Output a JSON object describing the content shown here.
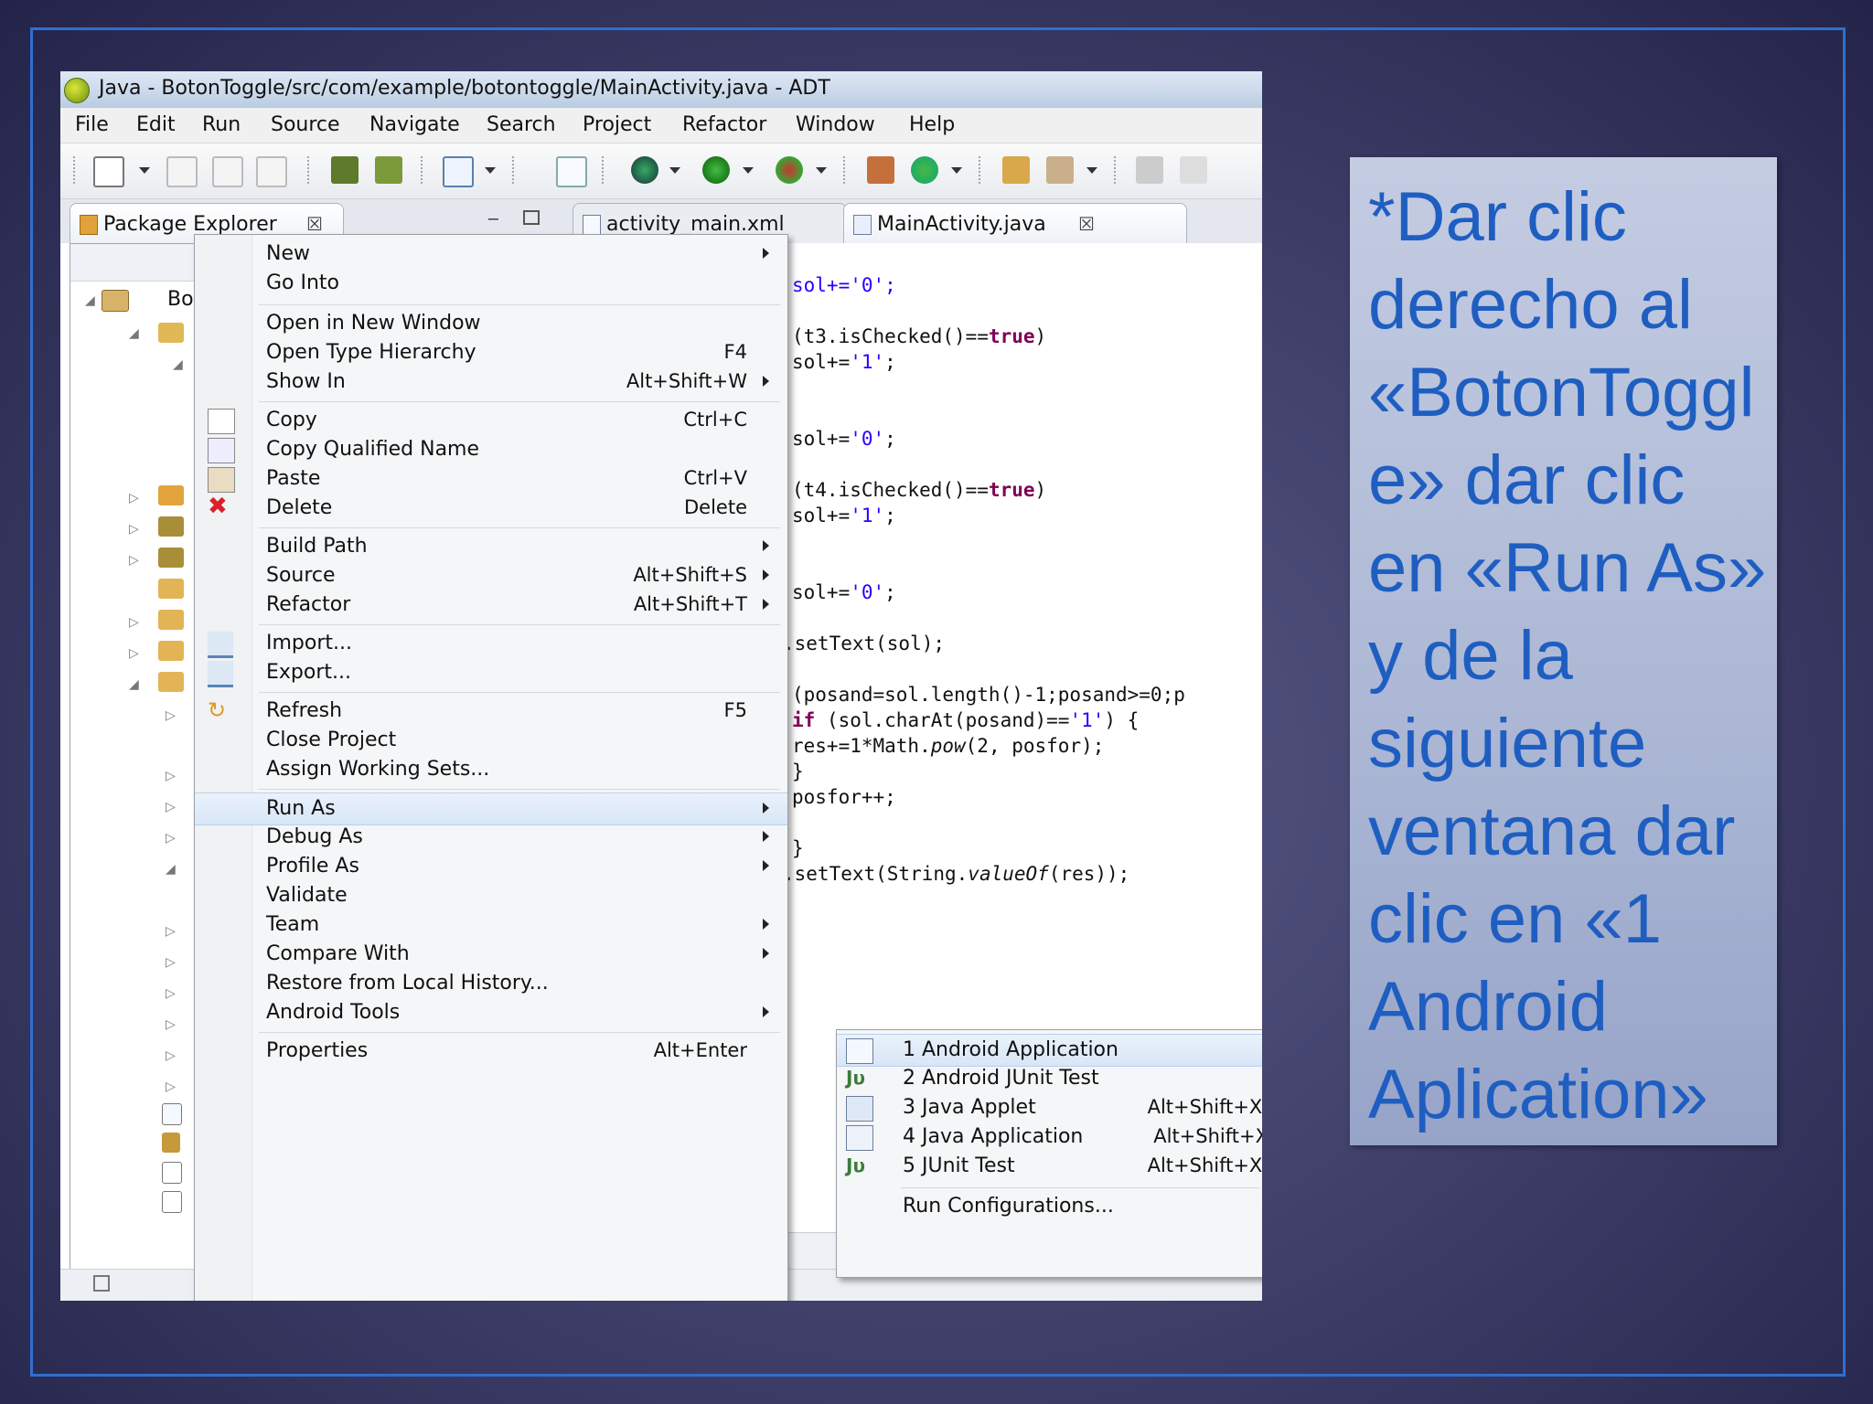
{
  "window": {
    "title": "Java - BotonToggle/src/com/example/botontoggle/MainActivity.java - ADT"
  },
  "menubar": [
    "File",
    "Edit",
    "Run",
    "Source",
    "Navigate",
    "Search",
    "Project",
    "Refactor",
    "Window",
    "Help"
  ],
  "tabs": {
    "package_explorer": "Package Explorer",
    "activity_main": "activity_main.xml",
    "main_activity": "MainActivity.java",
    "close_glyph": "☒"
  },
  "tree": {
    "project_label": "Bot"
  },
  "code_lines": [
    "sol+='0';",
    "(t3.isChecked()==true)",
    "sol+='1';",
    "sol+='0';",
    "(t4.isChecked()==true)",
    "sol+='1';",
    "sol+='0';",
    ".setText(sol);",
    "(posand=sol.length()-1;posand>=0;p",
    "if (sol.charAt(posand)=='1') {",
    "res+=1*Math.pow(2, posfor);",
    "}",
    "posfor++;",
    "}",
    ".setText(String.valueOf(res));"
  ],
  "context_menu": {
    "items": [
      {
        "label": "New",
        "accel": "",
        "submenu": true
      },
      {
        "label": "Go Into",
        "accel": "",
        "submenu": false
      },
      {
        "label": "Open in New Window",
        "accel": "",
        "submenu": false
      },
      {
        "label": "Open Type Hierarchy",
        "accel": "F4",
        "submenu": false
      },
      {
        "label": "Show In",
        "accel": "Alt+Shift+W",
        "submenu": true
      },
      {
        "label": "Copy",
        "accel": "Ctrl+C",
        "submenu": false
      },
      {
        "label": "Copy Qualified Name",
        "accel": "",
        "submenu": false
      },
      {
        "label": "Paste",
        "accel": "Ctrl+V",
        "submenu": false
      },
      {
        "label": "Delete",
        "accel": "Delete",
        "submenu": false
      },
      {
        "label": "Build Path",
        "accel": "",
        "submenu": true
      },
      {
        "label": "Source",
        "accel": "Alt+Shift+S",
        "submenu": true
      },
      {
        "label": "Refactor",
        "accel": "Alt+Shift+T",
        "submenu": true
      },
      {
        "label": "Import...",
        "accel": "",
        "submenu": false
      },
      {
        "label": "Export...",
        "accel": "",
        "submenu": false
      },
      {
        "label": "Refresh",
        "accel": "F5",
        "submenu": false
      },
      {
        "label": "Close Project",
        "accel": "",
        "submenu": false
      },
      {
        "label": "Assign Working Sets...",
        "accel": "",
        "submenu": false
      },
      {
        "label": "Run As",
        "accel": "",
        "submenu": true
      },
      {
        "label": "Debug As",
        "accel": "",
        "submenu": true
      },
      {
        "label": "Profile As",
        "accel": "",
        "submenu": true
      },
      {
        "label": "Validate",
        "accel": "",
        "submenu": false
      },
      {
        "label": "Team",
        "accel": "",
        "submenu": true
      },
      {
        "label": "Compare With",
        "accel": "",
        "submenu": true
      },
      {
        "label": "Restore from Local History...",
        "accel": "",
        "submenu": false
      },
      {
        "label": "Android Tools",
        "accel": "",
        "submenu": true
      },
      {
        "label": "Properties",
        "accel": "Alt+Enter",
        "submenu": false
      }
    ]
  },
  "run_as_submenu": {
    "items": [
      {
        "label": "1 Android Application",
        "accel": ""
      },
      {
        "label": "2 Android JUnit Test",
        "accel": ""
      },
      {
        "label": "3 Java Applet",
        "accel": "Alt+Shift+X,"
      },
      {
        "label": "4 Java Application",
        "accel": "Alt+Shift+X"
      },
      {
        "label": "5 JUnit Test",
        "accel": "Alt+Shift+X,"
      },
      {
        "label": "Run Configurations...",
        "accel": ""
      }
    ]
  },
  "caption": {
    "text": "*Dar clic derecho al «BotonToggle» dar clic en «Run As» y de la siguiente ventana dar clic en «1 Android Aplication»"
  },
  "colors": {
    "caption_text": "#1f5ec1",
    "keyword": "#7f0055",
    "string": "#2a00ff",
    "slide_border": "#2f6fd0"
  }
}
